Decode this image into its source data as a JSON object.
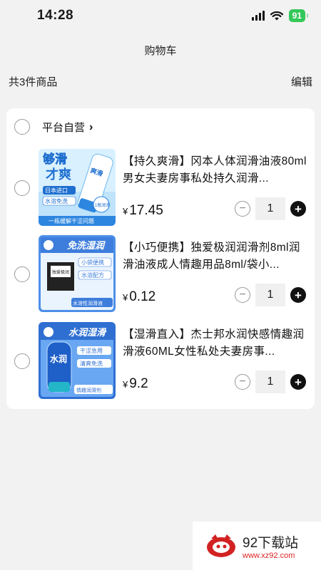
{
  "status_bar": {
    "time": "14:28",
    "battery": "91"
  },
  "header": {
    "title": "购物车"
  },
  "summary": {
    "count_text": "共3件商品",
    "edit_label": "编辑"
  },
  "store": {
    "name": "平台自营"
  },
  "items": [
    {
      "title": "【持久爽滑】冈本人体润滑油液80ml男女夫妻房事私处持久润滑...",
      "currency": "¥",
      "price": "17.45",
      "quantity": "1",
      "thumb_text": {
        "line1": "够滑",
        "line2": "才爽",
        "tag1": "日本进口",
        "tag2": "水溶免洗",
        "footer": "一瓶缓解干涩问题",
        "badge": "1瓶润滑",
        "bottle": "爽滑"
      }
    },
    {
      "title": "【小巧便携】独爱极润润滑剂8ml润滑油液成人情趣用品8ml/袋小...",
      "currency": "¥",
      "price": "0.12",
      "quantity": "1",
      "thumb_text": {
        "line1": "免洗湿润",
        "tag1": "小袋便携",
        "tag2": "水溶配方",
        "tag3": "水溶性润滑液",
        "pack": "独爱极润"
      }
    },
    {
      "title": "【湿滑直入】杰士邦水润快感情趣润滑液60ML女性私处夫妻房事...",
      "currency": "¥",
      "price": "9.2",
      "quantity": "1",
      "thumb_text": {
        "line1": "水润湿滑",
        "tag1": "干涩急用",
        "tag2": "清爽免洗",
        "tag3": "情趣润滑剂",
        "bottle": "水润"
      }
    }
  ],
  "watermark": {
    "title": "92下载站",
    "url": "www.xz92.com"
  },
  "colors": {
    "accent_battery": "#34c759",
    "thumb_blue": "#2d6fd6",
    "watermark_red": "#d22222"
  }
}
